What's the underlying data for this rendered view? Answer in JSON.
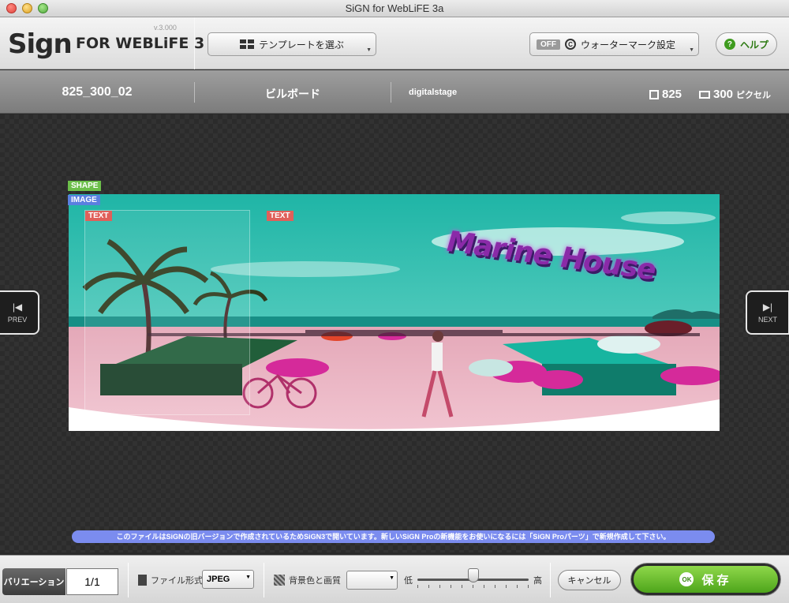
{
  "window": {
    "title": "SiGN for WebLiFE 3a"
  },
  "logo": {
    "version": "v.3.000",
    "main": "Sign",
    "sub": "FOR WEBLiFE 3"
  },
  "toolbar": {
    "template_label": "テンプレートを選ぶ",
    "watermark_state": "OFF",
    "watermark_label": "ウォーターマーク設定",
    "help_label": "ヘルプ"
  },
  "info": {
    "name": "825_300_02",
    "type": "ビルボード",
    "author": "digitalstage",
    "width": "825",
    "height": "300",
    "unit": "ピクセル"
  },
  "canvas": {
    "tags": {
      "shape": "SHAPE",
      "image": "IMAGE",
      "text1": "TEXT",
      "text2": "TEXT"
    },
    "headline": "Marine House",
    "prev_label": "PREV",
    "next_label": "NEXT",
    "notice": "このファイルはSiGNの旧バージョンで作成されているためSiGN3で開いています。新しいSiGN Proの新機能をお使いになるには「SiGN Proパーツ」で新規作成して下さい。"
  },
  "bottom": {
    "variation_label": "バリエーション",
    "variation_value": "1/1",
    "file_format_label": "ファイル形式",
    "file_format_value": "JPEG",
    "bg_quality_label": "背景色と画質",
    "bg_value": "",
    "quality_low": "低",
    "quality_high": "高",
    "quality_level": 0.5,
    "cancel_label": "キャンセル",
    "ok_badge": "OK",
    "save_label": "保存"
  },
  "icons": {
    "template": "grid-icon",
    "watermark": "copyright-icon",
    "help": "question-icon",
    "width": "width-frame-icon",
    "height": "height-frame-icon",
    "prev": "skip-back-icon",
    "next": "skip-forward-icon",
    "file": "file-icon",
    "background": "checker-icon"
  }
}
